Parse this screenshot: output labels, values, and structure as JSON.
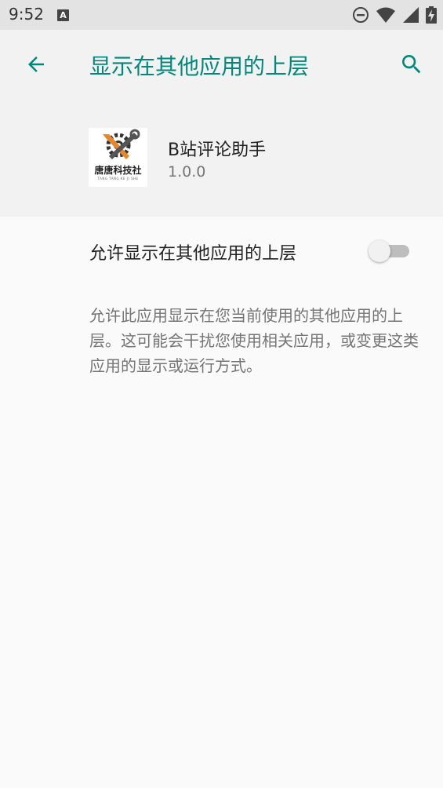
{
  "status_bar": {
    "time": "9:52",
    "notification_icon": "A",
    "icons": [
      "do-not-disturb-icon",
      "wifi-icon",
      "signal-icon",
      "battery-charging-icon"
    ]
  },
  "app_bar": {
    "title": "显示在其他应用的上层",
    "back_icon": "arrow-back-icon",
    "search_icon": "search-icon"
  },
  "app_info": {
    "name": "B站评论助手",
    "version": "1.0.0",
    "logo_text": "唐唐科技社",
    "logo_subtext": "TANG TANG KE JI SHE"
  },
  "permission": {
    "label": "允许显示在其他应用的上层",
    "enabled": false,
    "summary": "允许此应用显示在您当前使用的其他应用的上层。这可能会干扰您使用相关应用，或变更这类应用的显示或运行方式。"
  },
  "colors": {
    "accent": "#00897b",
    "status_bar_bg": "#e3e3e3",
    "header_bg": "#f2f2f2",
    "page_bg": "#fafafa"
  }
}
